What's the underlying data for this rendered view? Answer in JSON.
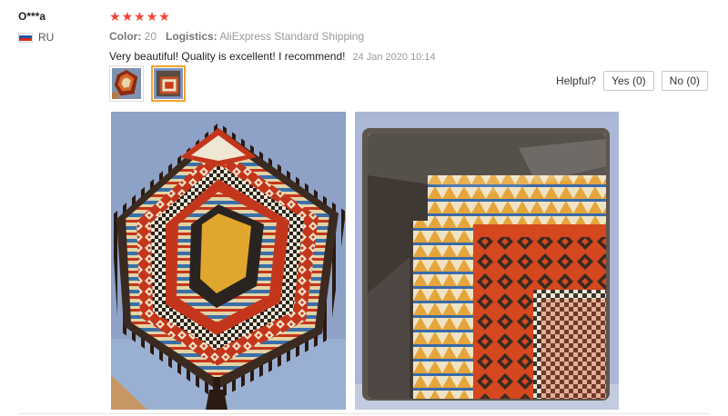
{
  "reviewer": {
    "name": "O***a",
    "country_code": "RU",
    "flag_colors": [
      "#ffffff",
      "#1c57a5",
      "#d52b1e"
    ]
  },
  "review": {
    "rating": 5,
    "star_glyph": "★",
    "star_color": "#f44336",
    "color_label": "Color:",
    "color_value": "20",
    "logistics_label": "Logistics:",
    "logistics_value": "AliExpress Standard Shipping",
    "text": "Very beautiful! Quality is excellent! I recommend!",
    "date": "24 Jan 2020 10:14"
  },
  "helpful": {
    "label": "Helpful?",
    "yes_label": "Yes (0)",
    "no_label": "No (0)"
  },
  "thumbnails": [
    {
      "name": "photo-thumbnail-1",
      "selected": false
    },
    {
      "name": "photo-thumbnail-2",
      "selected": true
    }
  ],
  "photos": [
    {
      "name": "scarf-unfolded-photo"
    },
    {
      "name": "scarf-packaged-photo"
    }
  ],
  "colors": {
    "accent_orange": "#f0a52b",
    "text_muted": "#999999"
  }
}
